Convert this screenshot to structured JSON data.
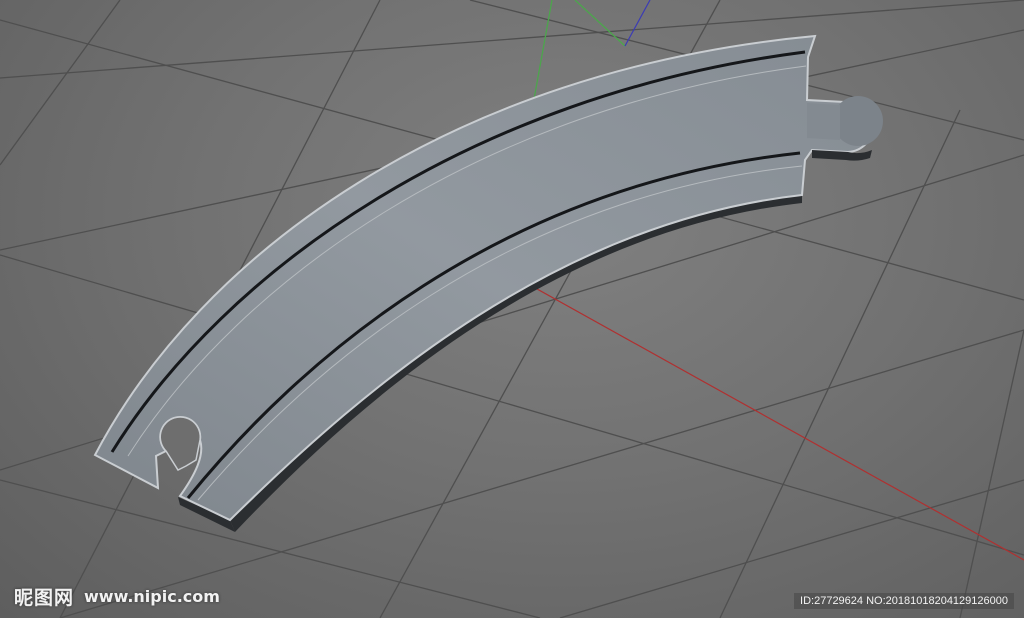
{
  "scene": {
    "object": "curved-track-piece",
    "colors": {
      "background": "#6b6b6b",
      "grid_line": "#4f4f4f",
      "track_face": "#8f969d",
      "track_side": "#2b2e31",
      "track_edge": "#c9cdd1",
      "axis_x": "#b03030",
      "axis_y": "#4aa84a",
      "axis_z": "#3b3bb5"
    }
  },
  "watermark": {
    "brand_cn": "昵图网",
    "url": "www.nipic.com",
    "id_text": "ID:27729624 NO:20181018204129126000"
  }
}
